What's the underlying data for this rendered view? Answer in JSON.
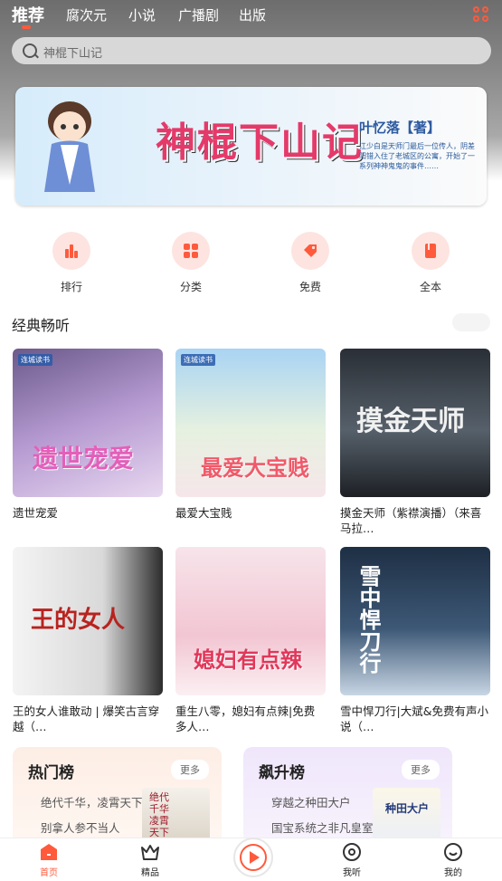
{
  "tabs": [
    "推荐",
    "腐次元",
    "小说",
    "广播剧",
    "出版"
  ],
  "search": {
    "placeholder": "神棍下山记"
  },
  "banner": {
    "title": "神棍下山记",
    "author": "叶忆落【著】",
    "blurb": "江少白是天师门最后一位传人，阴差阳错入住了老城区的公寓，开始了一系列神神鬼鬼的事件……"
  },
  "quick_nav": [
    {
      "label": "排行",
      "icon": "bar-chart-icon"
    },
    {
      "label": "分类",
      "icon": "grid-icon"
    },
    {
      "label": "免费",
      "icon": "tag-icon"
    },
    {
      "label": "全本",
      "icon": "book-icon"
    }
  ],
  "section": {
    "title": "经典畅听"
  },
  "cards": [
    {
      "title": "遗世宠爱",
      "cover_text": "遗世宠爱",
      "badge": "连城读书"
    },
    {
      "title": "最爱大宝贱",
      "cover_text": "最爱大宝贱",
      "badge": "连城读书"
    },
    {
      "title": "摸金天师（紫襟演播）（来喜马拉…",
      "cover_text": "摸金天师"
    },
    {
      "title": "王的女人谁敢动 | 爆笑古言穿越（…",
      "cover_text": "王的女人"
    },
    {
      "title": "重生八零，媳妇有点辣|免费多人…",
      "cover_text": "媳妇有点辣"
    },
    {
      "title": "雪中悍刀行|大斌&免费有声小说（…",
      "cover_text": "雪中悍刀行"
    }
  ],
  "rank_boards": [
    {
      "title": "热门榜",
      "more": "更多",
      "items": [
        "绝代千华，凌霄天下",
        "别拿人参不当人"
      ],
      "thumb_text": "绝代千华凌霄天下"
    },
    {
      "title": "飙升榜",
      "more": "更多",
      "items": [
        "穿越之种田大户",
        "国宝系统之非凡皇室"
      ],
      "thumb_text": "种田大户"
    }
  ],
  "bottom_nav": [
    {
      "label": "首页",
      "icon": "home-icon",
      "active": true
    },
    {
      "label": "精品",
      "icon": "crown-icon"
    },
    {
      "label": "我听",
      "icon": "disc-icon"
    },
    {
      "label": "我的",
      "icon": "smile-icon"
    }
  ],
  "colors": {
    "accent": "#ff5a3c",
    "header_gray": "#7a7a7a"
  }
}
